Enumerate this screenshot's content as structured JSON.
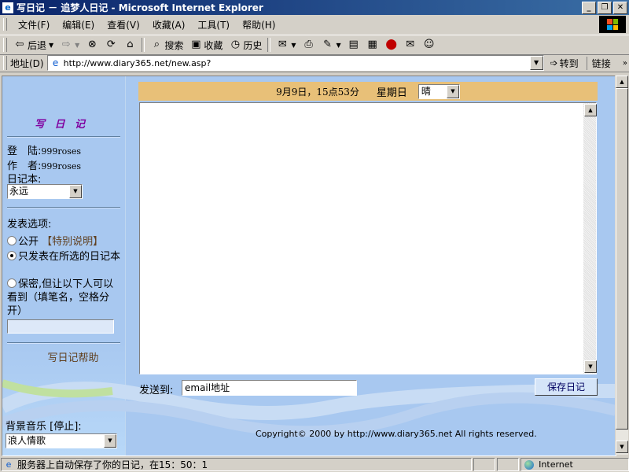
{
  "window": {
    "title": "写日记 － 追梦人日记 - Microsoft Internet Explorer"
  },
  "menu": {
    "items": [
      "文件(F)",
      "编辑(E)",
      "查看(V)",
      "收藏(A)",
      "工具(T)",
      "帮助(H)"
    ]
  },
  "toolbar": {
    "back": "后退",
    "search": "搜索",
    "favorites": "收藏",
    "history": "历史"
  },
  "address": {
    "label": "地址(D)",
    "url": "http://www.diary365.net/new.asp?",
    "go": "转到",
    "links": "链接"
  },
  "left": {
    "title": "写 日 记",
    "login_label": "登　陆:",
    "login_value": "999roses",
    "author_label": "作　者:",
    "author_value": "999roses",
    "diary_label": "日记本:",
    "diary_value": "永远",
    "options_label": "发表选项:",
    "opt_public": "公开",
    "special_note": "【特别说明】",
    "opt_selected": "只发表在所选的日记本",
    "opt_private": "保密,但让以下人可以看到（填笔名，空格分开）",
    "help": "写日记帮助",
    "music_label": "背景音乐 [停止]:",
    "music_value": "浪人情歌"
  },
  "main": {
    "date": "9月9日，15点53分",
    "weekday": "星期日",
    "weather": "晴",
    "sendto_label": "发送到:",
    "email_value": "email地址",
    "save_button": "保存日记",
    "copyright": "Copyright© 2000 by http://www.diary365.net All rights reserved."
  },
  "status": {
    "text": "服务器上自动保存了你的日记，在15：50：1",
    "zone": "Internet"
  },
  "colors": {
    "content_bg": "#a8c8f0",
    "date_bar": "#e8c078",
    "title_gradient_start": "#0a246a",
    "title_text_purple": "#8000a0"
  }
}
